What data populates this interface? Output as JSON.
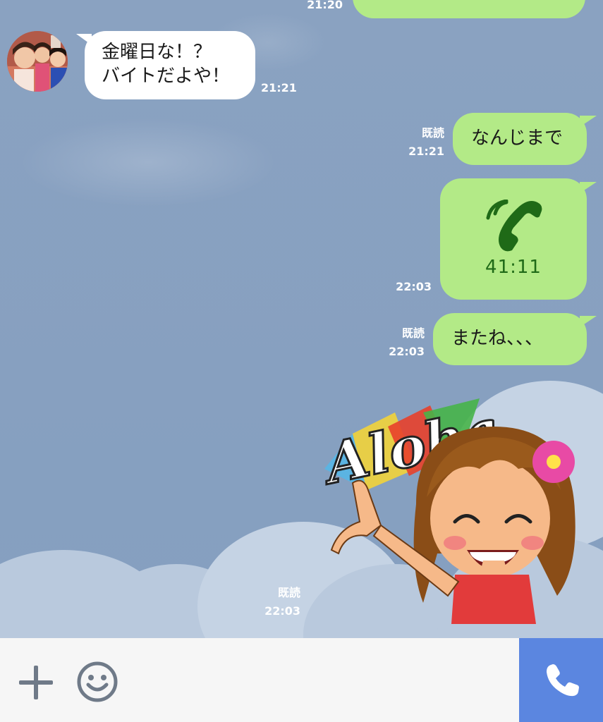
{
  "messages": {
    "top_partial": {
      "time": "21:20"
    },
    "incoming_1": {
      "line1": "金曜日な！？",
      "line2": "バイトだよや！",
      "time": "21:21"
    },
    "outgoing_1": {
      "text": "なんじまで",
      "read": "既読",
      "time": "21:21"
    },
    "outgoing_call": {
      "duration": "41:11",
      "time": "22:03"
    },
    "outgoing_2": {
      "text": "またね、、、",
      "read": "既読",
      "time": "22:03"
    },
    "sticker": {
      "text": "Aloha",
      "read": "既読",
      "time": "22:03"
    }
  },
  "composer": {
    "add_icon": "plus-icon",
    "emoji_icon": "smiley-icon",
    "call_icon": "phone-icon"
  },
  "colors": {
    "background": "#8aa2c1",
    "outgoing_bubble": "#b3ea87",
    "incoming_bubble": "#ffffff",
    "call_button": "#5b86e0",
    "call_icon_green": "#1f6a17"
  }
}
